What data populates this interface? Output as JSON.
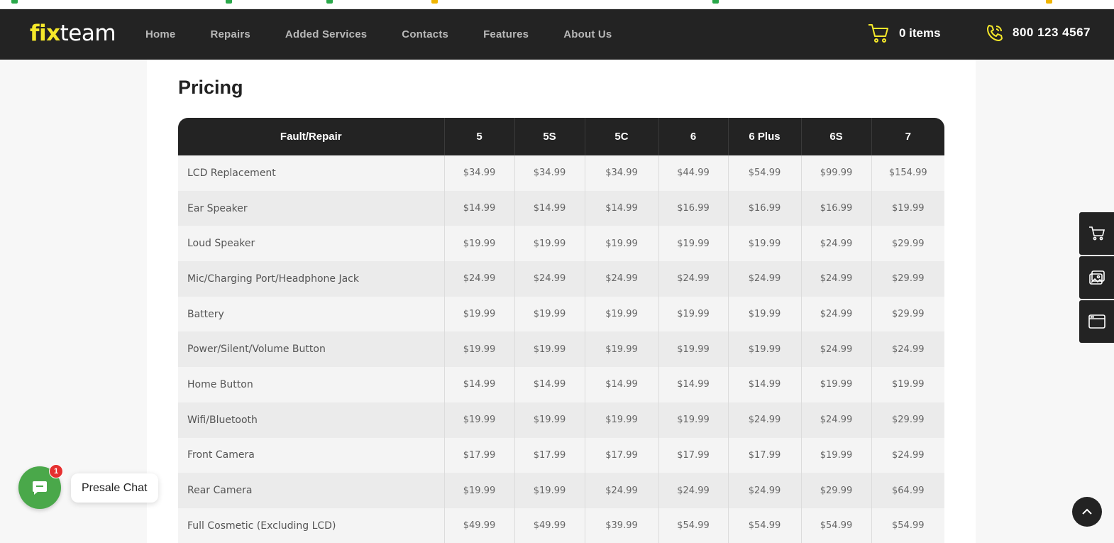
{
  "header": {
    "logo_fix": "fix",
    "logo_team": "team",
    "nav": [
      "Home",
      "Repairs",
      "Added Services",
      "Contacts",
      "Features",
      "About Us"
    ],
    "cart_label": "0 items",
    "phone": "800 123 4567",
    "accent_color": "#f5e82a"
  },
  "main": {
    "title": "Pricing",
    "columns": [
      "Fault/Repair",
      "5",
      "5S",
      "5C",
      "6",
      "6 Plus",
      "6S",
      "7"
    ],
    "rows": [
      [
        "LCD Replacement",
        "$34.99",
        "$34.99",
        "$34.99",
        "$44.99",
        "$54.99",
        "$99.99",
        "$154.99"
      ],
      [
        "Ear Speaker",
        "$14.99",
        "$14.99",
        "$14.99",
        "$16.99",
        "$16.99",
        "$16.99",
        "$19.99"
      ],
      [
        "Loud Speaker",
        "$19.99",
        "$19.99",
        "$19.99",
        "$19.99",
        "$19.99",
        "$24.99",
        "$29.99"
      ],
      [
        "Mic/Charging Port/Headphone Jack",
        "$24.99",
        "$24.99",
        "$24.99",
        "$24.99",
        "$24.99",
        "$24.99",
        "$29.99"
      ],
      [
        "Battery",
        "$19.99",
        "$19.99",
        "$19.99",
        "$19.99",
        "$19.99",
        "$24.99",
        "$29.99"
      ],
      [
        "Power/Silent/Volume Button",
        "$19.99",
        "$19.99",
        "$19.99",
        "$19.99",
        "$19.99",
        "$24.99",
        "$24.99"
      ],
      [
        "Home Button",
        "$14.99",
        "$14.99",
        "$14.99",
        "$14.99",
        "$14.99",
        "$19.99",
        "$19.99"
      ],
      [
        "Wifi/Bluetooth",
        "$19.99",
        "$19.99",
        "$19.99",
        "$19.99",
        "$24.99",
        "$24.99",
        "$29.99"
      ],
      [
        "Front Camera",
        "$17.99",
        "$17.99",
        "$17.99",
        "$17.99",
        "$17.99",
        "$19.99",
        "$24.99"
      ],
      [
        "Rear Camera",
        "$19.99",
        "$19.99",
        "$24.99",
        "$24.99",
        "$24.99",
        "$29.99",
        "$64.99"
      ],
      [
        "Full Cosmetic (Excluding LCD)",
        "$49.99",
        "$49.99",
        "$39.99",
        "$54.99",
        "$54.99",
        "$54.99",
        "$54.99"
      ]
    ]
  },
  "chat": {
    "label": "Presale Chat",
    "badge": "1",
    "color": "#4aa84a"
  },
  "sidetools": [
    "cart-icon",
    "gallery-icon",
    "browser-window-icon"
  ]
}
